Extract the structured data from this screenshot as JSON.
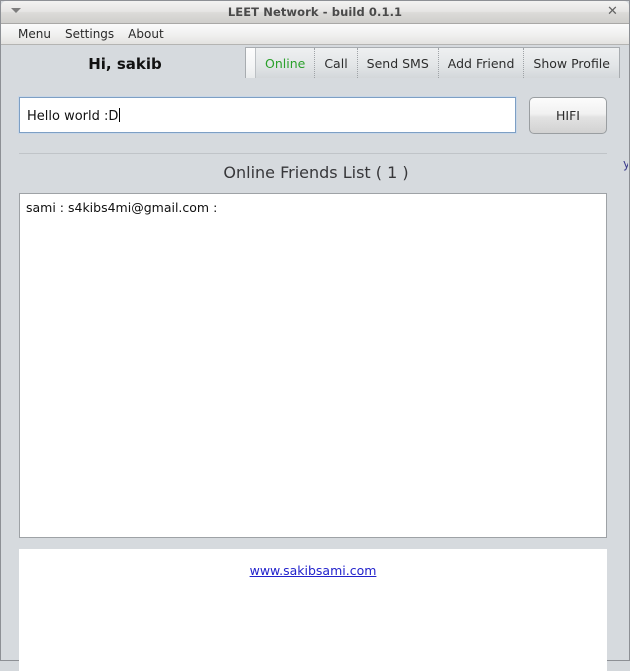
{
  "window": {
    "title": "LEET Network - build 0.1.1",
    "menu_icon": "caret-down-icon",
    "close_icon": "✕"
  },
  "menubar": {
    "items": [
      {
        "label": "Menu"
      },
      {
        "label": "Settings"
      },
      {
        "label": "About"
      }
    ]
  },
  "header": {
    "greeting": "Hi, sakib"
  },
  "tabs": {
    "active_color": "#2aa02a",
    "items": [
      {
        "label": "Online",
        "active": true
      },
      {
        "label": "Call",
        "active": false
      },
      {
        "label": "Send SMS",
        "active": false
      },
      {
        "label": "Add Friend",
        "active": false
      },
      {
        "label": "Show Profile",
        "active": false
      }
    ]
  },
  "compose": {
    "message_value": "Hello world :D",
    "message_placeholder": "",
    "send_button_label": "HIFI"
  },
  "friends": {
    "title": "Online Friends List ( 1 )",
    "count": 1,
    "items": [
      {
        "text": "sami : s4kibs4mi@gmail.com :"
      }
    ]
  },
  "footer": {
    "link_text": "www.sakibsami.com",
    "link_color": "#2222cc"
  }
}
